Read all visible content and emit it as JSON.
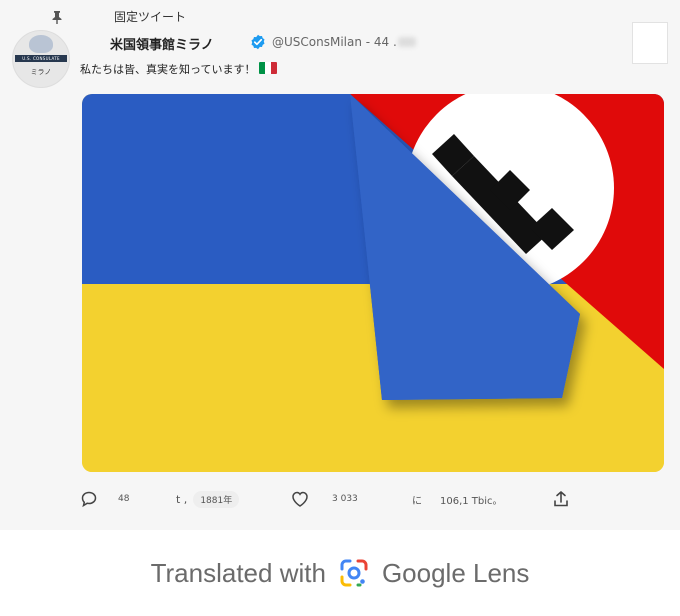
{
  "pinned_label": "固定ツイート",
  "avatar": {
    "band_text": "U.S. CONSULATE",
    "sub_text": "ミラノ"
  },
  "account": {
    "name": "米国領事館ミラノ",
    "handle": "@USConsMilan - 44 ."
  },
  "tweet": {
    "text": "私たちは皆、真実を知っています！",
    "emoji": "italian-flag"
  },
  "media": {
    "description": "ukraine-flag-over-nazi-flag"
  },
  "actions": {
    "replies": "48",
    "retweet_prefix": "t ,",
    "retweets": "1881年",
    "likes": "3 033",
    "views_prefix": "に",
    "views": "106,1 Tbic。"
  },
  "footer": {
    "prefix": "Translated with",
    "brand": "Google Lens"
  },
  "colors": {
    "ukraine_blue": "#2a5cc2",
    "ukraine_yellow": "#f3d12f",
    "red": "#e00a0a",
    "verified_blue": "#1d9bf0"
  }
}
